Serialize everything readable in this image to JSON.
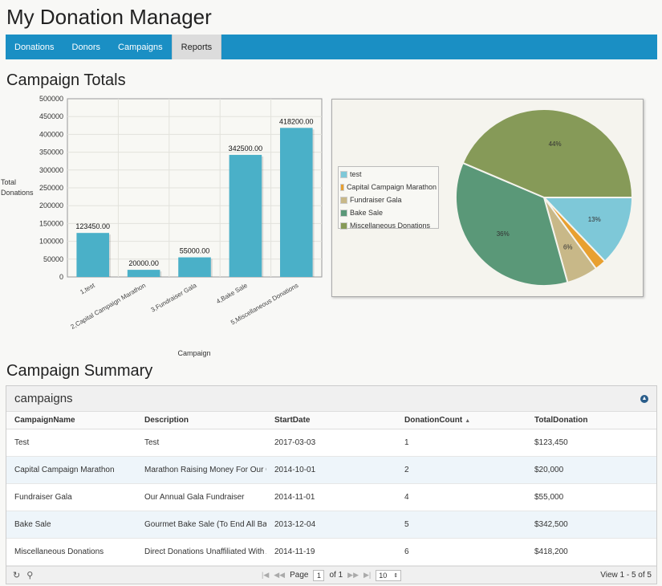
{
  "app": {
    "title": "My Donation Manager"
  },
  "nav": {
    "items": [
      {
        "label": "Donations",
        "active": false
      },
      {
        "label": "Donors",
        "active": false
      },
      {
        "label": "Campaigns",
        "active": false
      },
      {
        "label": "Reports",
        "active": true
      }
    ]
  },
  "sections": {
    "totals_title": "Campaign Totals",
    "summary_title": "Campaign Summary"
  },
  "colors": {
    "nav": "#1a8fc4",
    "bar": "#4ab0c8",
    "pie": [
      "#7ec8d8",
      "#e8a030",
      "#c8b888",
      "#5a9878",
      "#869a58"
    ]
  },
  "chart_data": [
    {
      "type": "bar",
      "categories": [
        "1,test",
        "2,Capital Campaign Marathon",
        "3,Fundraiser Gala",
        "4,Bake Sale",
        "5,Miscellaneous Donations"
      ],
      "values": [
        123450,
        20000,
        55000,
        342500,
        418200
      ],
      "data_labels": [
        "123450.00",
        "20000.00",
        "55000.00",
        "342500.00",
        "418200.00"
      ],
      "xlabel": "Campaign",
      "ylabel": "Total Donations",
      "ylim": [
        0,
        500000
      ],
      "yticks": [
        "0",
        "50000",
        "100000",
        "150000",
        "200000",
        "250000",
        "300000",
        "350000",
        "400000",
        "450000",
        "500000"
      ],
      "grid": true
    },
    {
      "type": "pie",
      "categories": [
        "test",
        "Capital Campaign Marathon",
        "Fundraiser Gala",
        "Bake Sale",
        "Miscellaneous Donations"
      ],
      "values": [
        123450,
        20000,
        55000,
        342500,
        418200
      ],
      "slice_labels": [
        "13%",
        "",
        "6%",
        "36%",
        "44%"
      ],
      "legend": "left"
    }
  ],
  "grid": {
    "caption": "campaigns",
    "columns": [
      "CampaignName",
      "Description",
      "StartDate",
      "DonationCount",
      "TotalDonation"
    ],
    "rows": [
      [
        "Test",
        "Test",
        "2017-03-03",
        "1",
        "$123,450"
      ],
      [
        "Capital Campaign Marathon",
        "Marathon Raising Money For Our Ca",
        "2014-10-01",
        "2",
        "$20,000"
      ],
      [
        "Fundraiser Gala",
        "Our Annual Gala Fundraiser",
        "2014-11-01",
        "4",
        "$55,000"
      ],
      [
        "Bake Sale",
        "Gourmet Bake Sale (To End All Bake",
        "2013-12-04",
        "5",
        "$342,500"
      ],
      [
        "Miscellaneous Donations",
        "Direct Donations Unaffiliated With A",
        "2014-11-19",
        "6",
        "$418,200"
      ]
    ],
    "pager": {
      "page_label": "Page",
      "page": "1",
      "of_label": "of 1",
      "rows_per_page": "10",
      "view_text": "View 1 - 5 of 5"
    }
  }
}
